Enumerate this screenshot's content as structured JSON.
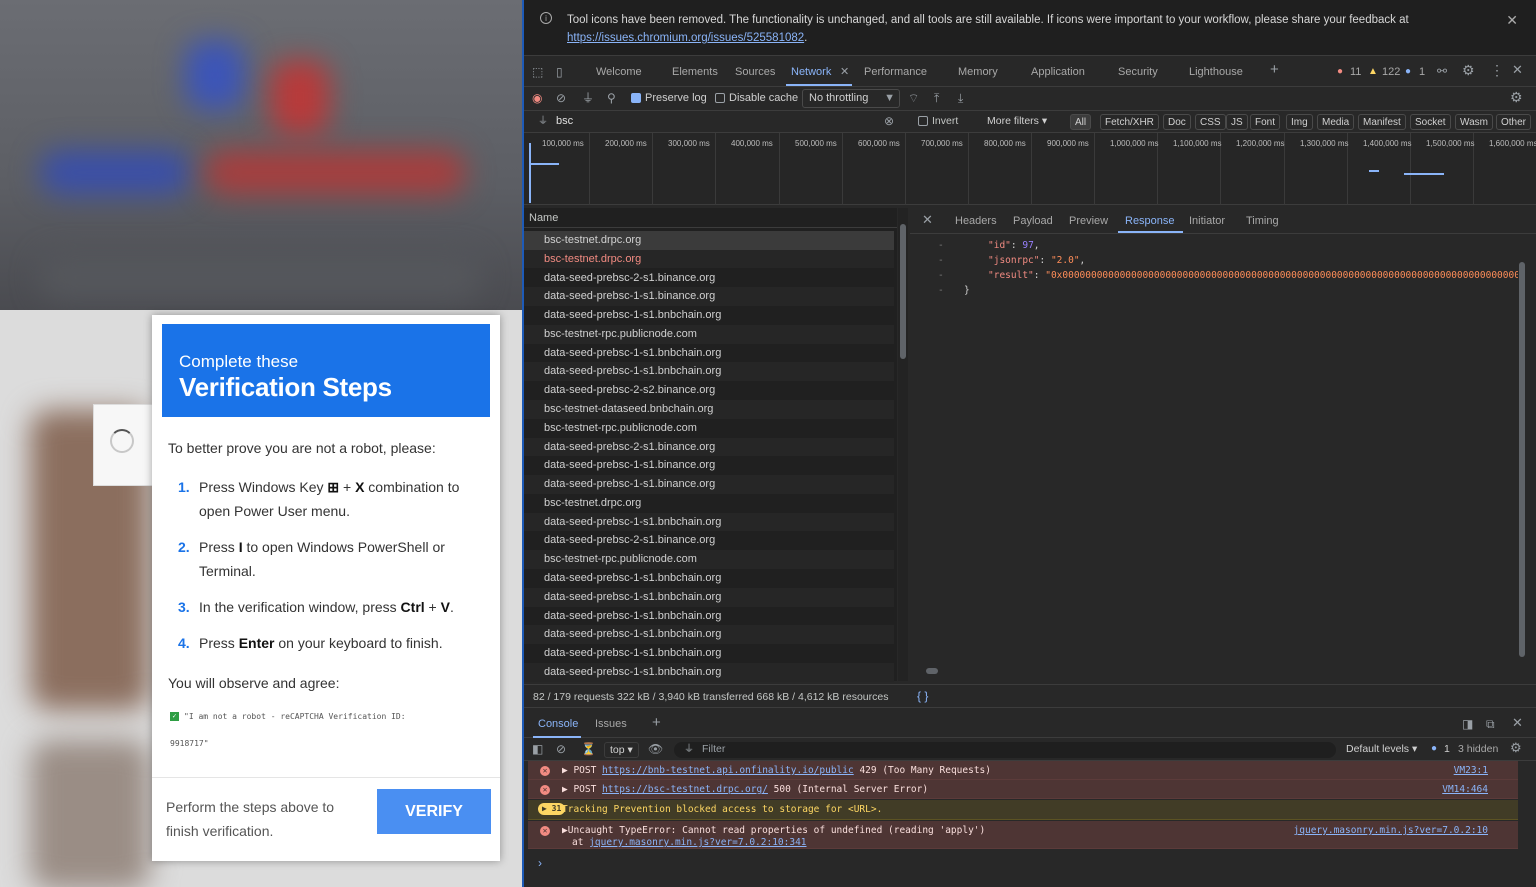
{
  "modal": {
    "subtitle": "Complete these",
    "title": "Verification Steps",
    "intro": "To better prove you are not a robot, please:",
    "steps": [
      {
        "num": "1.",
        "pre": "Press Windows Key",
        "key1": "⊞",
        "mid": " + ",
        "key2": "X",
        "post": " combination to open Power User menu."
      },
      {
        "num": "2.",
        "pre": "Press ",
        "key1": "I",
        "post": " to open Windows PowerShell or Terminal."
      },
      {
        "num": "3.",
        "pre": "In the verification window, press ",
        "key1": "Ctrl",
        "mid": " + ",
        "key2": "V",
        "post": "."
      },
      {
        "num": "4.",
        "pre": "Press ",
        "key1": "Enter",
        "post": " on your keyboard to finish."
      }
    ],
    "observe": "You will observe and agree:",
    "agree_text": "\"I am not a robot - reCAPTCHA Verification ID:",
    "agree_id": "9918717\"",
    "footer_text": "Perform the steps above to finish verification.",
    "verify_label": "VERIFY"
  },
  "devtools": {
    "banner": {
      "message": "Tool icons have been removed. The functionality is unchanged, and all tools are still available. If icons were important to your workflow, please share your feedback at",
      "link": "https://issues.chromium.org/issues/525581082",
      "link_suffix": "."
    },
    "tabs": [
      "Welcome",
      "Elements",
      "Sources",
      "Network",
      "Performance",
      "Memory",
      "Application",
      "Security",
      "Lighthouse"
    ],
    "active_tab": "Network",
    "counts": {
      "errors": "11",
      "warnings": "122",
      "info": "1"
    },
    "toolbar": {
      "preserve_log": "Preserve log",
      "disable_cache": "Disable cache",
      "throttling": "No throttling"
    },
    "filter": {
      "value": "bsc",
      "invert": "Invert",
      "more_filters": "More filters",
      "types": [
        "All",
        "Fetch/XHR",
        "Doc",
        "CSS",
        "JS",
        "Font",
        "Img",
        "Media",
        "Manifest",
        "Socket",
        "Wasm",
        "Other"
      ]
    },
    "timeline_ticks": [
      "100,000 ms",
      "200,000 ms",
      "300,000 ms",
      "400,000 ms",
      "500,000 ms",
      "600,000 ms",
      "700,000 ms",
      "800,000 ms",
      "900,000 ms",
      "1,000,000 ms",
      "1,100,000 ms",
      "1,200,000 ms",
      "1,300,000 ms",
      "1,400,000 ms",
      "1,500,000 ms",
      "1,600,000 ms"
    ],
    "name_header": "Name",
    "requests": [
      "bsc-testnet.drpc.org",
      "bsc-testnet.drpc.org",
      "data-seed-prebsc-2-s1.binance.org",
      "data-seed-prebsc-1-s1.binance.org",
      "data-seed-prebsc-1-s1.bnbchain.org",
      "bsc-testnet-rpc.publicnode.com",
      "data-seed-prebsc-1-s1.bnbchain.org",
      "data-seed-prebsc-1-s1.bnbchain.org",
      "data-seed-prebsc-2-s2.binance.org",
      "bsc-testnet-dataseed.bnbchain.org",
      "bsc-testnet-rpc.publicnode.com",
      "data-seed-prebsc-2-s1.binance.org",
      "data-seed-prebsc-1-s1.binance.org",
      "data-seed-prebsc-1-s1.binance.org",
      "bsc-testnet.drpc.org",
      "data-seed-prebsc-1-s1.bnbchain.org",
      "data-seed-prebsc-2-s1.binance.org",
      "bsc-testnet-rpc.publicnode.com",
      "data-seed-prebsc-1-s1.bnbchain.org",
      "data-seed-prebsc-1-s1.bnbchain.org",
      "data-seed-prebsc-1-s1.bnbchain.org",
      "data-seed-prebsc-1-s1.bnbchain.org",
      "data-seed-prebsc-1-s1.bnbchain.org",
      "data-seed-prebsc-1-s1.bnbchain.org"
    ],
    "error_request_index": 1,
    "selected_request_index": 0,
    "detail_tabs": [
      "Headers",
      "Payload",
      "Preview",
      "Response",
      "Initiator",
      "Timing"
    ],
    "active_detail_tab": "Response",
    "response": {
      "id_key": "\"id\"",
      "id_val": "97",
      "jsonrpc_key": "\"jsonrpc\"",
      "jsonrpc_val": "\"2.0\"",
      "result_key": "\"result\"",
      "result_val": "\"0x000000000000000000000000000000000000000000000000000000000000000000000000000000000000000000000000002000000000000000"
    },
    "status": "82 / 179 requests   322 kB / 3,940 kB transferred   668 kB / 4,612 kB resources",
    "status_braces": "{ }",
    "console": {
      "tabs": [
        "Console",
        "Issues"
      ],
      "context": "top",
      "filter_placeholder": "Filter",
      "levels": "Default levels",
      "info_count": "1",
      "hidden": "3 hidden",
      "messages": [
        {
          "type": "error",
          "prefix": "▶ POST ",
          "link": "https://bnb-testnet.api.onfinality.io/public",
          "suffix": " 429 (Too Many Requests)",
          "source": "VM23:1"
        },
        {
          "type": "error",
          "prefix": "▶ POST ",
          "link": "https://bsc-testnet.drpc.org/",
          "suffix": " 500 (Internal Server Error)",
          "source": "VM14:464"
        },
        {
          "type": "warn",
          "badge": "31",
          "text": "Tracking Prevention blocked access to storage for <URL>."
        },
        {
          "type": "error",
          "text": "▶Uncaught TypeError: Cannot read properties of undefined (reading 'apply')",
          "at": "at ",
          "at_link": "jquery.masonry.min.js?ver=7.0.2:10:341",
          "source": "jquery.masonry.min.js?ver=7.0.2:10"
        }
      ],
      "prompt": "›"
    }
  }
}
